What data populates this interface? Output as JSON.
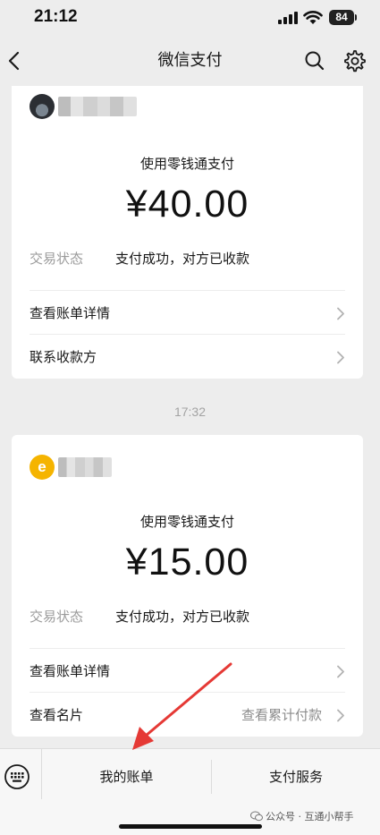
{
  "status_bar": {
    "time": "21:12",
    "battery": "84"
  },
  "nav": {
    "title": "微信支付"
  },
  "card1": {
    "pay_method": "使用零钱通支付",
    "amount": "¥40.00",
    "status_label": "交易状态",
    "status_value": "支付成功，对方已收款",
    "row_a": "查看账单详情",
    "row_b": "联系收款方"
  },
  "timestamp": "17:32",
  "card2": {
    "avatar_letter": "e",
    "pay_method": "使用零钱通支付",
    "amount": "¥15.00",
    "status_label": "交易状态",
    "status_value": "支付成功，对方已收款",
    "row_a": "查看账单详情",
    "row_b": "查看名片",
    "row_b_right": "查看累计付款"
  },
  "bottom_bar": {
    "bills_label": "我的账单",
    "services_label": "支付服务"
  },
  "watermark": "公众号 · 互通小帮手",
  "colors": {
    "background": "#ededed",
    "card": "#ffffff",
    "arrow": "#e53935"
  }
}
